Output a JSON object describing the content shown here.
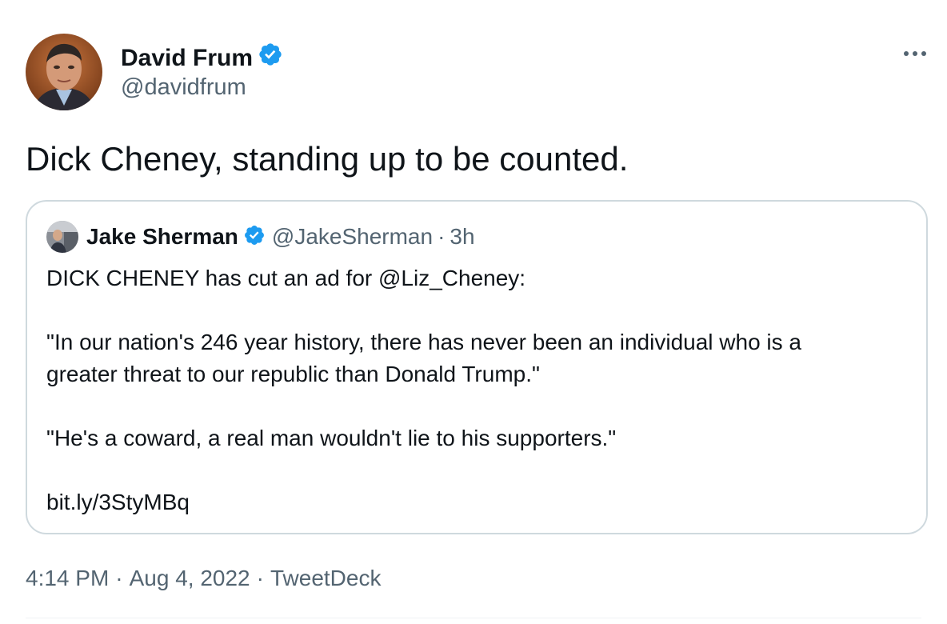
{
  "author": {
    "display_name": "David Frum",
    "handle": "@davidfrum",
    "verified": true
  },
  "tweet": {
    "text": "Dick Cheney, standing up to be counted."
  },
  "quoted_tweet": {
    "display_name": "Jake Sherman",
    "handle": "@JakeSherman",
    "separator": "·",
    "time": "3h",
    "verified": true,
    "body": {
      "line1": "DICK CHENEY has cut an ad for @Liz_Cheney:",
      "line2a": "\"In our nation's 246 year history, there has never been an individual who is a",
      "line2b": "greater threat to our republic than Donald Trump.\"",
      "line3": "\"He's a coward, a real man wouldn't lie to his supporters.\"",
      "line4": "bit.ly/3StyMBq"
    }
  },
  "meta": {
    "time": "4:14 PM",
    "date": "Aug 4, 2022",
    "source": "TweetDeck",
    "separator": "·"
  },
  "icons": {
    "verified": "verified-badge-icon",
    "more": "more-horizontal-icon"
  },
  "colors": {
    "verified_blue": "#1d9bf0",
    "secondary_text": "#536471",
    "primary_text": "#0f1419",
    "border": "#cfd9de"
  }
}
